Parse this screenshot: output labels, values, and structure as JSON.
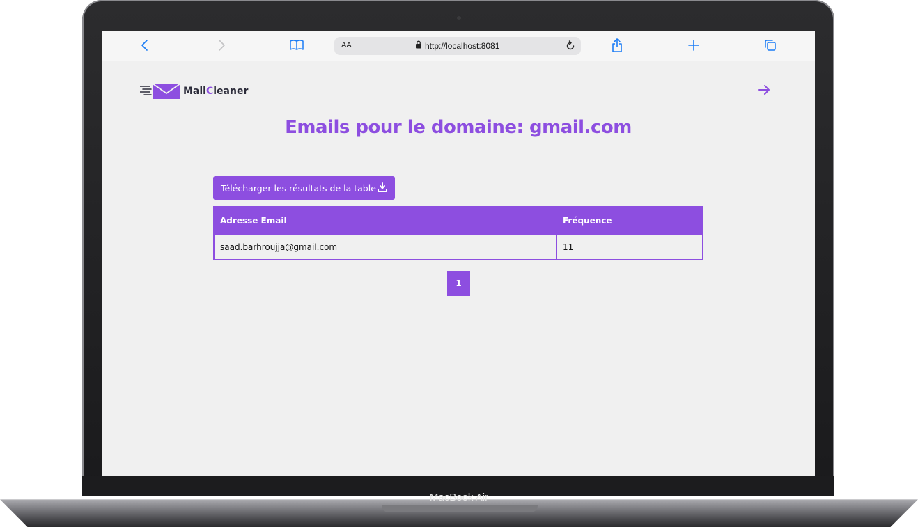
{
  "device": {
    "model": "MacBook Air"
  },
  "browser": {
    "text_size_label": "AA",
    "url": "http://localhost:8081"
  },
  "app": {
    "logo": {
      "first": "Mail",
      "accent": "C",
      "rest": "leaner"
    },
    "page_title": "Emails pour le domaine: gmail.com",
    "download_button_label": "Télécharger les résultats de la table",
    "table": {
      "headers": [
        "Adresse Email",
        "Fréquence"
      ],
      "rows": [
        {
          "email": "saad.barhroujja@gmail.com",
          "frequency": "11"
        }
      ]
    },
    "pagination": {
      "current_page": "1"
    },
    "colors": {
      "accent": "#8d4ee0",
      "background": "#f0f0f0",
      "browser_blue": "#1a7cf5"
    }
  }
}
